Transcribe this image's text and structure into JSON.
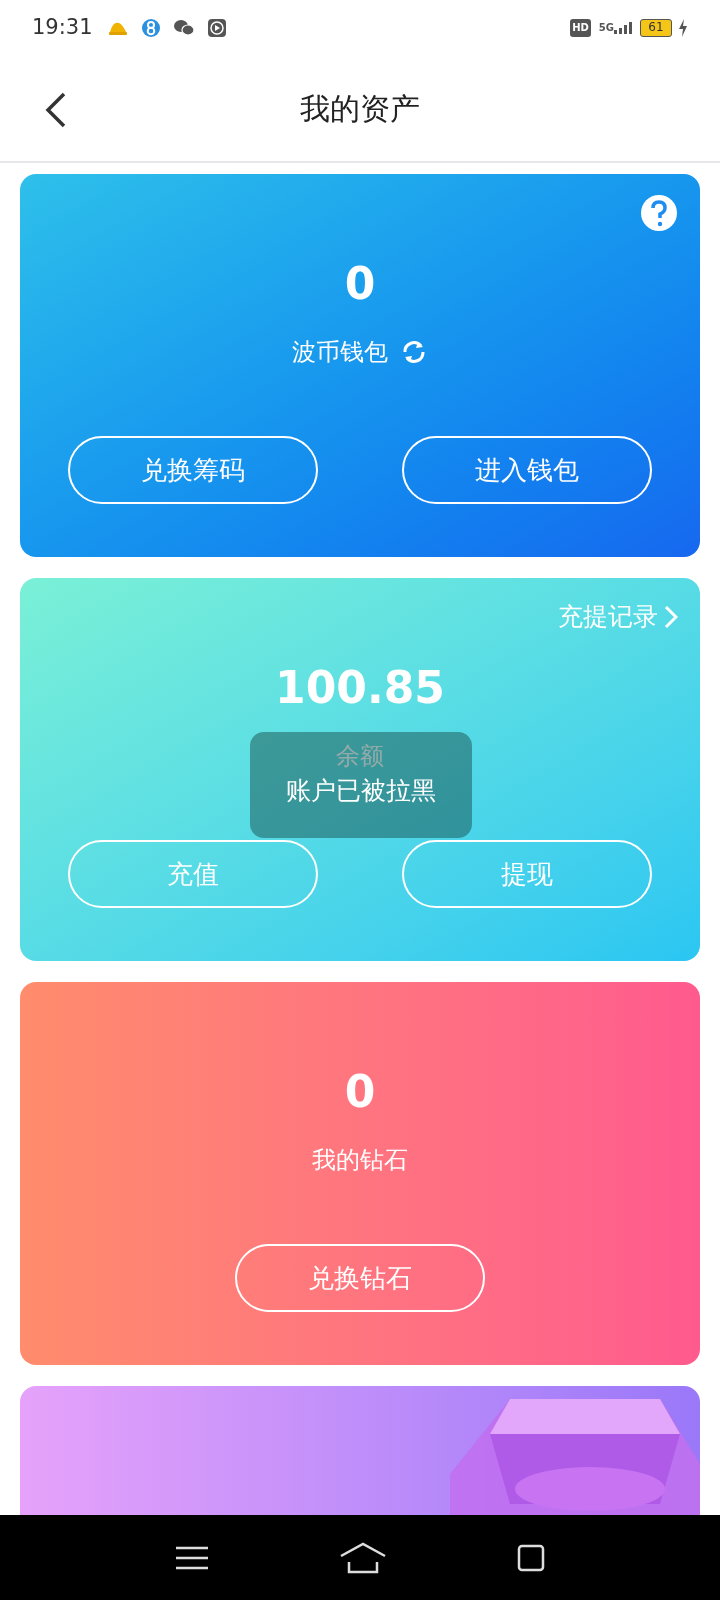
{
  "status_bar": {
    "time": "19:31",
    "network": "5G",
    "quality": "HD",
    "battery": "61"
  },
  "header": {
    "title": "我的资产"
  },
  "cards": [
    {
      "kind": "wallet",
      "amount": "0",
      "label": "波币钱包",
      "buttons": [
        "兑换筹码",
        "进入钱包"
      ]
    },
    {
      "kind": "balance",
      "link": "充提记录",
      "amount": "100.85",
      "label": "余额",
      "buttons": [
        "充值",
        "提现"
      ]
    },
    {
      "kind": "diamond",
      "amount": "0",
      "label": "我的钻石",
      "buttons": [
        "兑换钻石"
      ]
    },
    {
      "kind": "gem"
    }
  ],
  "toast": {
    "text": "账户已被拉黑"
  }
}
